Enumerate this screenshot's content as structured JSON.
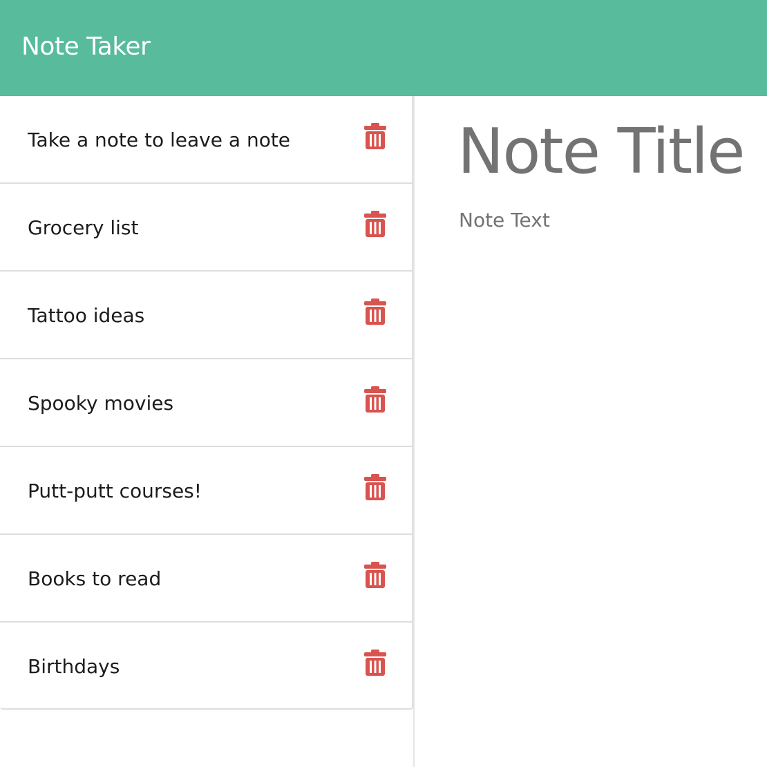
{
  "navbar": {
    "title": "Note Taker",
    "color": "#57bb9c"
  },
  "sidebar": {
    "notes": [
      {
        "title": "Take a note to leave a note"
      },
      {
        "title": "Grocery list"
      },
      {
        "title": "Tattoo ideas"
      },
      {
        "title": "Spooky movies"
      },
      {
        "title": "Putt-putt courses!"
      },
      {
        "title": "Books to read"
      },
      {
        "title": "Birthdays"
      }
    ],
    "delete_icon": "trash-icon",
    "delete_color": "#d9534f"
  },
  "editor": {
    "title_placeholder": "Note Title",
    "text_placeholder": "Note Text"
  }
}
